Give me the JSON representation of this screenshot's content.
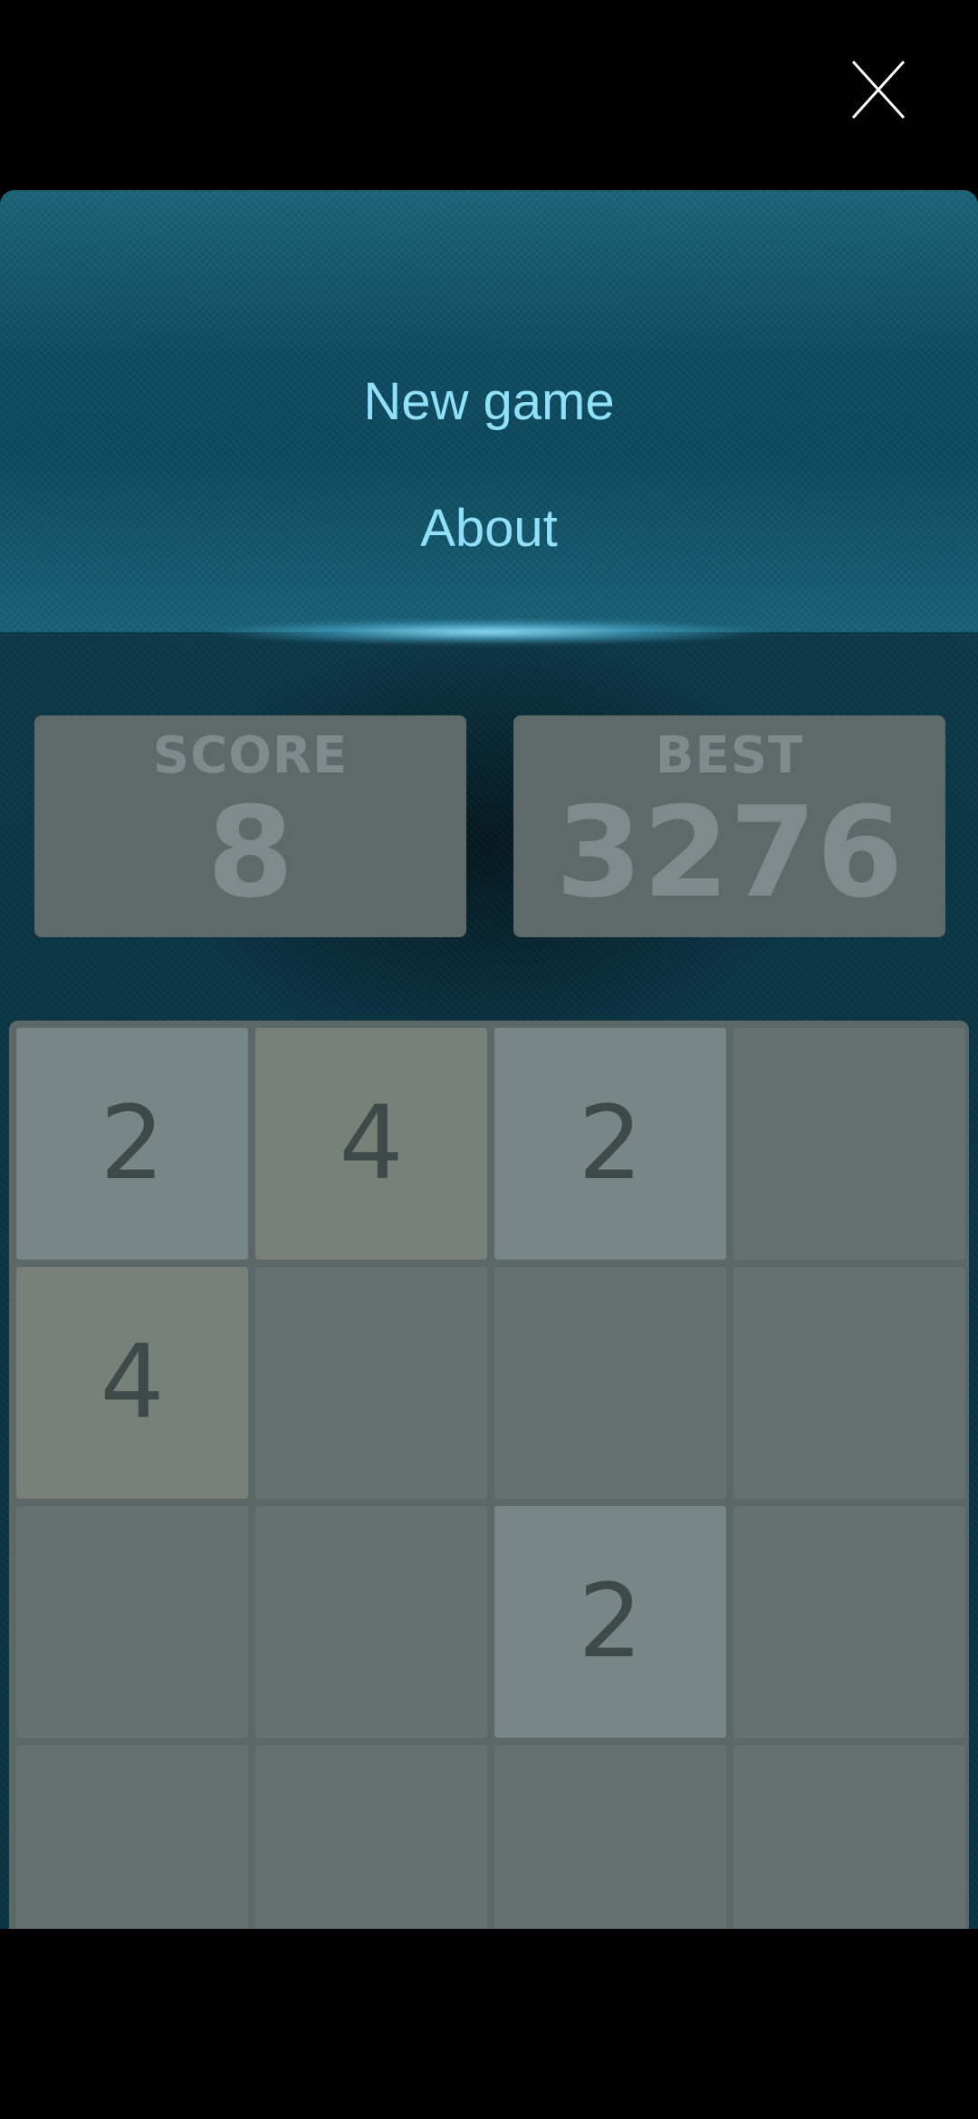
{
  "icons": {
    "close": "close-icon"
  },
  "menu": {
    "new_game": "New game",
    "about": "About"
  },
  "scores": {
    "score_label": "SCORE",
    "score_value": "8",
    "best_label": "BEST",
    "best_value": "3276"
  },
  "board": {
    "rows": [
      [
        "2",
        "4",
        "2",
        ""
      ],
      [
        "4",
        "",
        "",
        ""
      ],
      [
        "",
        "",
        "2",
        ""
      ],
      [
        "",
        "",
        "",
        ""
      ]
    ]
  },
  "colors": {
    "menu_text": "#8fe0f8",
    "panel_top": "#1c6478",
    "board_bg": "#5c6868",
    "empty_cell": "#657171",
    "tile_2": "#778787",
    "tile_4": "#778179",
    "tile_text": "#3e4a4a",
    "score_box": "#5e6a6a",
    "score_text": "#7e8a8c"
  }
}
